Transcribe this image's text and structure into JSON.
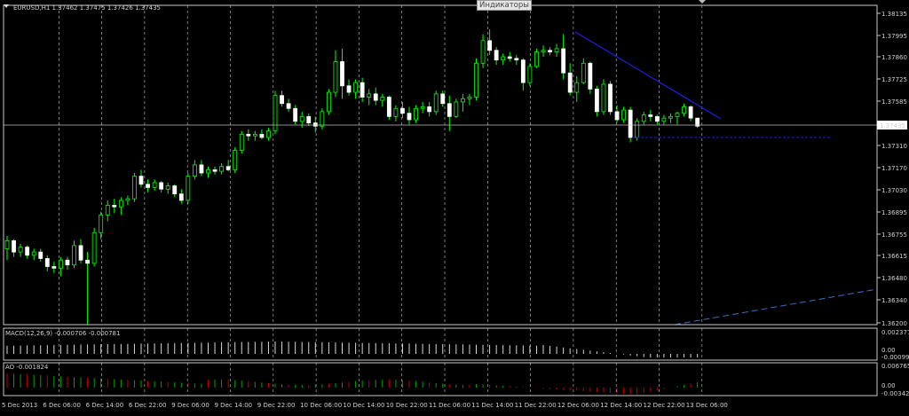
{
  "symbol_info": "EURUSD,H1  1.37462 1.37475 1.37426 1.37435",
  "indicators_button": "Индикаторы",
  "colors": {
    "background": "#000000",
    "bull": "#00ff00",
    "bear": "#ffffff",
    "trendline": "#1e1ee6",
    "grid": "#ffffff",
    "axis_text": "#d0d0d0",
    "histogram_up": "#00a000",
    "histogram_down": "#c00000"
  },
  "price_axis": {
    "ticks": [
      "1.38135",
      "1.37995",
      "1.37860",
      "1.37725",
      "1.37585",
      "1.37310",
      "1.37170",
      "1.37030",
      "1.36895",
      "1.36755",
      "1.36615",
      "1.36480",
      "1.36340",
      "1.36200"
    ],
    "current_price": "1.37435"
  },
  "time_axis": {
    "ticks": [
      "5 Dec 2013",
      "6 Dec 06:00",
      "6 Dec 14:00",
      "6 Dec 22:00",
      "9 Dec 06:00",
      "9 Dec 14:00",
      "9 Dec 22:00",
      "10 Dec 06:00",
      "10 Dec 14:00",
      "10 Dec 22:00",
      "11 Dec 06:00",
      "11 Dec 14:00",
      "11 Dec 22:00",
      "12 Dec 06:00",
      "12 Dec 14:00",
      "12 Dec 22:00",
      "13 Dec 06:00"
    ]
  },
  "macd": {
    "label": "MACD(12,26,9) -0.000706 -0.000781",
    "scale": [
      "0.002377",
      "0.00",
      "-0.000999"
    ]
  },
  "ao": {
    "label": "AO -0.001824",
    "scale": [
      "0.006765",
      "0.00",
      "-0.003424"
    ]
  },
  "chart_data": {
    "type": "candlestick",
    "symbol": "EURUSD",
    "timeframe": "H1",
    "ylim": [
      1.362,
      1.38135
    ],
    "ohlc": [
      [
        1.3667,
        1.3675,
        1.366,
        1.3672
      ],
      [
        1.3672,
        1.3673,
        1.3662,
        1.3665
      ],
      [
        1.3665,
        1.367,
        1.3662,
        1.3668
      ],
      [
        1.3668,
        1.3669,
        1.3661,
        1.3663
      ],
      [
        1.3663,
        1.3667,
        1.366,
        1.3665
      ],
      [
        1.3665,
        1.3667,
        1.3659,
        1.3661
      ],
      [
        1.3661,
        1.3663,
        1.3653,
        1.3656
      ],
      [
        1.3656,
        1.3659,
        1.3652,
        1.3655
      ],
      [
        1.3655,
        1.3662,
        1.365,
        1.366
      ],
      [
        1.366,
        1.3662,
        1.3654,
        1.3657
      ],
      [
        1.3657,
        1.3672,
        1.3655,
        1.3669
      ],
      [
        1.3669,
        1.3673,
        1.3658,
        1.366
      ],
      [
        1.366,
        1.3665,
        1.362,
        1.3658
      ],
      [
        1.3658,
        1.368,
        1.3656,
        1.3677
      ],
      [
        1.3677,
        1.369,
        1.3673,
        1.3688
      ],
      [
        1.3688,
        1.3697,
        1.3684,
        1.3694
      ],
      [
        1.3694,
        1.3698,
        1.3689,
        1.3693
      ],
      [
        1.3693,
        1.3699,
        1.3688,
        1.3697
      ],
      [
        1.3697,
        1.37,
        1.3694,
        1.3698
      ],
      [
        1.3698,
        1.3714,
        1.3696,
        1.3712
      ],
      [
        1.3712,
        1.3716,
        1.3705,
        1.3707
      ],
      [
        1.3707,
        1.371,
        1.3702,
        1.3705
      ],
      [
        1.3705,
        1.371,
        1.3703,
        1.3708
      ],
      [
        1.3708,
        1.3709,
        1.3702,
        1.3704
      ],
      [
        1.3704,
        1.3708,
        1.3701,
        1.3706
      ],
      [
        1.3706,
        1.3707,
        1.3699,
        1.3701
      ],
      [
        1.3701,
        1.3704,
        1.3695,
        1.3697
      ],
      [
        1.3697,
        1.3714,
        1.3695,
        1.3712
      ],
      [
        1.3712,
        1.3722,
        1.371,
        1.3719
      ],
      [
        1.3719,
        1.3722,
        1.3712,
        1.3714
      ],
      [
        1.3714,
        1.3718,
        1.3711,
        1.3716
      ],
      [
        1.3716,
        1.3718,
        1.3713,
        1.3715
      ],
      [
        1.3715,
        1.372,
        1.3713,
        1.3718
      ],
      [
        1.3718,
        1.3722,
        1.3715,
        1.3716
      ],
      [
        1.3716,
        1.373,
        1.3714,
        1.3728
      ],
      [
        1.3728,
        1.374,
        1.3726,
        1.3738
      ],
      [
        1.3738,
        1.3741,
        1.3734,
        1.3737
      ],
      [
        1.3737,
        1.374,
        1.3734,
        1.3738
      ],
      [
        1.3738,
        1.3741,
        1.3735,
        1.3736
      ],
      [
        1.3736,
        1.3742,
        1.3734,
        1.374
      ],
      [
        1.374,
        1.3765,
        1.3738,
        1.3762
      ],
      [
        1.3762,
        1.3765,
        1.3755,
        1.3757
      ],
      [
        1.3757,
        1.376,
        1.3752,
        1.3754
      ],
      [
        1.3754,
        1.3756,
        1.3744,
        1.3746
      ],
      [
        1.3746,
        1.3752,
        1.3742,
        1.3749
      ],
      [
        1.3749,
        1.3751,
        1.3743,
        1.3745
      ],
      [
        1.3745,
        1.3749,
        1.3739,
        1.3743
      ],
      [
        1.3743,
        1.3754,
        1.3741,
        1.3752
      ],
      [
        1.3752,
        1.3766,
        1.375,
        1.3764
      ],
      [
        1.3764,
        1.379,
        1.3761,
        1.3783
      ],
      [
        1.3783,
        1.3791,
        1.376,
        1.3768
      ],
      [
        1.3768,
        1.3772,
        1.3762,
        1.3764
      ],
      [
        1.3764,
        1.3772,
        1.376,
        1.377
      ],
      [
        1.377,
        1.3773,
        1.3758,
        1.3761
      ],
      [
        1.3761,
        1.3766,
        1.3756,
        1.3763
      ],
      [
        1.3763,
        1.3767,
        1.3756,
        1.3759
      ],
      [
        1.3759,
        1.3763,
        1.3755,
        1.3761
      ],
      [
        1.3761,
        1.3762,
        1.3747,
        1.3749
      ],
      [
        1.3749,
        1.3756,
        1.3746,
        1.3754
      ],
      [
        1.3754,
        1.3758,
        1.3748,
        1.3751
      ],
      [
        1.3751,
        1.3755,
        1.3744,
        1.3747
      ],
      [
        1.3747,
        1.3756,
        1.3745,
        1.3754
      ],
      [
        1.3754,
        1.3758,
        1.3751,
        1.3755
      ],
      [
        1.3755,
        1.3758,
        1.3749,
        1.3752
      ],
      [
        1.3752,
        1.3765,
        1.375,
        1.3763
      ],
      [
        1.3763,
        1.3765,
        1.3755,
        1.3757
      ],
      [
        1.3757,
        1.3762,
        1.374,
        1.3749
      ],
      [
        1.3749,
        1.376,
        1.3748,
        1.3758
      ],
      [
        1.3758,
        1.3763,
        1.3752,
        1.376
      ],
      [
        1.376,
        1.3763,
        1.3756,
        1.3761
      ],
      [
        1.3761,
        1.3785,
        1.3759,
        1.3782
      ],
      [
        1.3782,
        1.38,
        1.3779,
        1.3796
      ],
      [
        1.3796,
        1.3803,
        1.3787,
        1.379
      ],
      [
        1.379,
        1.3792,
        1.3781,
        1.3784
      ],
      [
        1.3784,
        1.3788,
        1.3781,
        1.3786
      ],
      [
        1.3786,
        1.3789,
        1.3783,
        1.3785
      ],
      [
        1.3785,
        1.3787,
        1.3781,
        1.3784
      ],
      [
        1.3784,
        1.3785,
        1.3765,
        1.377
      ],
      [
        1.377,
        1.3782,
        1.3768,
        1.378
      ],
      [
        1.378,
        1.3791,
        1.3779,
        1.3789
      ],
      [
        1.3789,
        1.3793,
        1.3786,
        1.379
      ],
      [
        1.379,
        1.3792,
        1.3787,
        1.3789
      ],
      [
        1.3789,
        1.3794,
        1.3786,
        1.3791
      ],
      [
        1.3791,
        1.38,
        1.3772,
        1.3776
      ],
      [
        1.3776,
        1.3782,
        1.3762,
        1.3764
      ],
      [
        1.3764,
        1.3774,
        1.3758,
        1.377
      ],
      [
        1.377,
        1.3785,
        1.3769,
        1.3782
      ],
      [
        1.3782,
        1.3783,
        1.3763,
        1.3766
      ],
      [
        1.3766,
        1.3768,
        1.3749,
        1.3752
      ],
      [
        1.3752,
        1.3772,
        1.375,
        1.3769
      ],
      [
        1.3769,
        1.3771,
        1.375,
        1.3752
      ],
      [
        1.3752,
        1.3756,
        1.3745,
        1.3747
      ],
      [
        1.3747,
        1.3755,
        1.3745,
        1.3753
      ],
      [
        1.3753,
        1.3755,
        1.3733,
        1.3736
      ],
      [
        1.3736,
        1.3748,
        1.3734,
        1.3746
      ],
      [
        1.3746,
        1.3752,
        1.3744,
        1.375
      ],
      [
        1.375,
        1.3753,
        1.3746,
        1.3749
      ],
      [
        1.3749,
        1.375,
        1.3744,
        1.3746
      ],
      [
        1.3746,
        1.375,
        1.3744,
        1.3748
      ],
      [
        1.3748,
        1.3751,
        1.3745,
        1.3749
      ],
      [
        1.3749,
        1.3752,
        1.3744,
        1.3751
      ],
      [
        1.3751,
        1.3757,
        1.3749,
        1.3755
      ],
      [
        1.3755,
        1.3756,
        1.3746,
        1.3748
      ],
      [
        1.3748,
        1.3746,
        1.3742,
        1.3743
      ]
    ]
  }
}
